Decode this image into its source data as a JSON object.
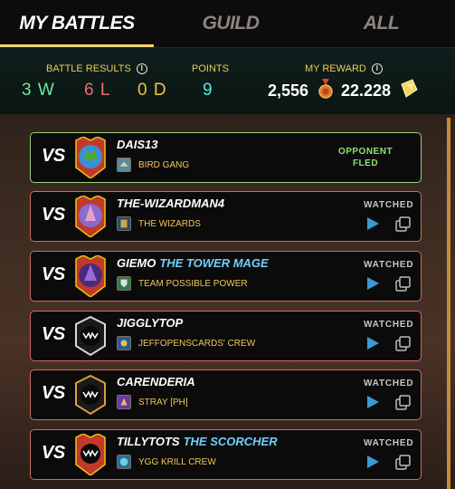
{
  "tabs": [
    {
      "label": "MY BATTLES",
      "active": true
    },
    {
      "label": "GUILD",
      "active": false
    },
    {
      "label": "ALL",
      "active": false
    }
  ],
  "stats": {
    "battle_results_label": "BATTLE RESULTS",
    "wins": "3 W",
    "losses": "6 L",
    "draws": "0 D",
    "points_label": "POINTS",
    "points": "9",
    "reward_label": "MY REWARD",
    "reward_medals": "2,556",
    "reward_tokens": "22.228"
  },
  "colors": {
    "accent_gold": "#f3d36a",
    "win": "#6ee8a0",
    "loss": "#ef6b74",
    "draw": "#f1c244",
    "points": "#57e6e0",
    "card_border_loss": "#d26a62",
    "card_border_fled": "#9bd07a",
    "title_blue": "#6ed0ff"
  },
  "battles": [
    {
      "vs": "VS",
      "player": "DAIS13",
      "title": "",
      "guild": "BIRD GANG",
      "status": "OPPONENT FLED",
      "watched_label": "",
      "icon": "green-dragon-avatar"
    },
    {
      "vs": "VS",
      "player": "THE-WIZARDMAN4",
      "title": "",
      "guild": "THE WIZARDS",
      "status": "WATCHED",
      "icon": "wizard-avatar"
    },
    {
      "vs": "VS",
      "player": "GIEMO",
      "title": "THE TOWER MAGE",
      "guild": "TEAM POSSIBLE POWER",
      "status": "WATCHED",
      "icon": "purple-mage-avatar"
    },
    {
      "vs": "VS",
      "player": "JIGGLYTOP",
      "title": "",
      "guild": "JEFFOPENSCARDS' CREW",
      "status": "WATCHED",
      "icon": "monster-mouth-avatar"
    },
    {
      "vs": "VS",
      "player": "CARENDERIA",
      "title": "",
      "guild": "STRAY [PH]",
      "status": "WATCHED",
      "icon": "monster-mouth-avatar"
    },
    {
      "vs": "VS",
      "player": "TILLYTOTS",
      "title": "THE SCORCHER",
      "guild": "YGG KRILL CREW",
      "status": "WATCHED",
      "icon": "monster-mouth-avatar"
    }
  ]
}
